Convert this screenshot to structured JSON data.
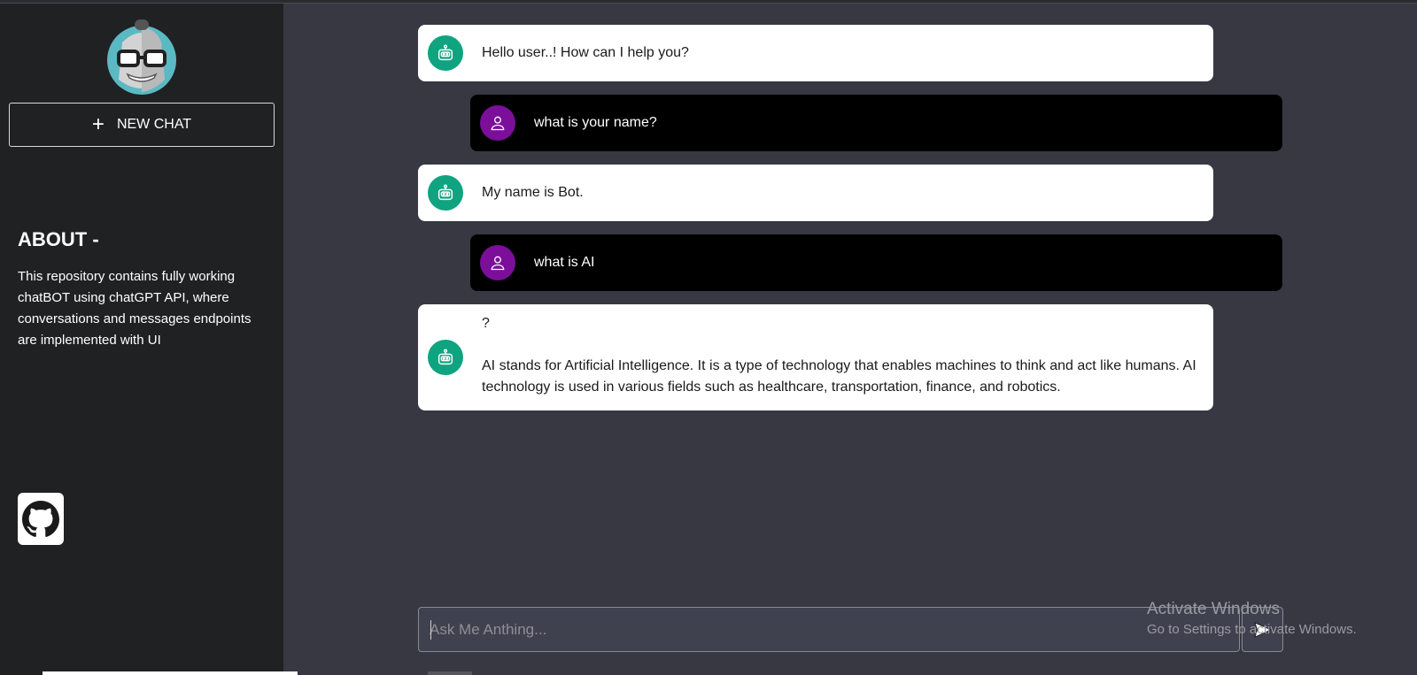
{
  "sidebar": {
    "new_chat_label": "NEW CHAT",
    "about_title": "ABOUT -",
    "about_text": "This repository contains fully working chatBOT using chatGPT API, where conversations and messages endpoints are implemented with UI",
    "logo_icon": "robot-with-glasses-logo",
    "github_icon": "github-icon"
  },
  "messages": [
    {
      "role": "bot",
      "text": "Hello user..! How can I help you?"
    },
    {
      "role": "user",
      "text": "what is your name?"
    },
    {
      "role": "bot",
      "text": "My name is Bot."
    },
    {
      "role": "user",
      "text": "what is AI"
    },
    {
      "role": "bot",
      "line1": "?",
      "line2": "AI stands for Artificial Intelligence. It is a type of technology that enables machines to think and act like humans. AI technology is used in various fields such as healthcare, transportation, finance, and robotics."
    }
  ],
  "input": {
    "placeholder": "Ask Me Anthing..."
  },
  "watermark": {
    "line1": "Activate Windows",
    "line2": "Go to Settings to activate Windows."
  },
  "colors": {
    "bot_avatar": "#10a37f",
    "user_avatar": "#7b0f9a",
    "main_bg": "#383843",
    "sidebar_bg": "#202123"
  }
}
